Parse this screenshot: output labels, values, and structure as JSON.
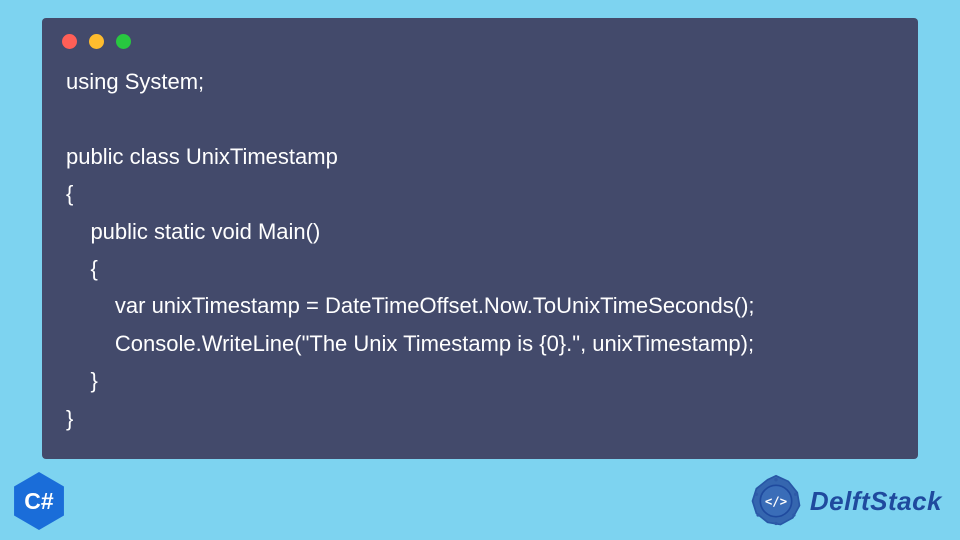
{
  "code": {
    "lines": [
      "using System;",
      "",
      "public class UnixTimestamp",
      "{",
      "    public static void Main()",
      "    {",
      "        var unixTimestamp = DateTimeOffset.Now.ToUnixTimeSeconds();",
      "        Console.WriteLine(\"The Unix Timestamp is {0}.\", unixTimestamp);",
      "    }",
      "}"
    ]
  },
  "badge": {
    "label": "C#"
  },
  "brand": {
    "name": "DelftStack"
  }
}
